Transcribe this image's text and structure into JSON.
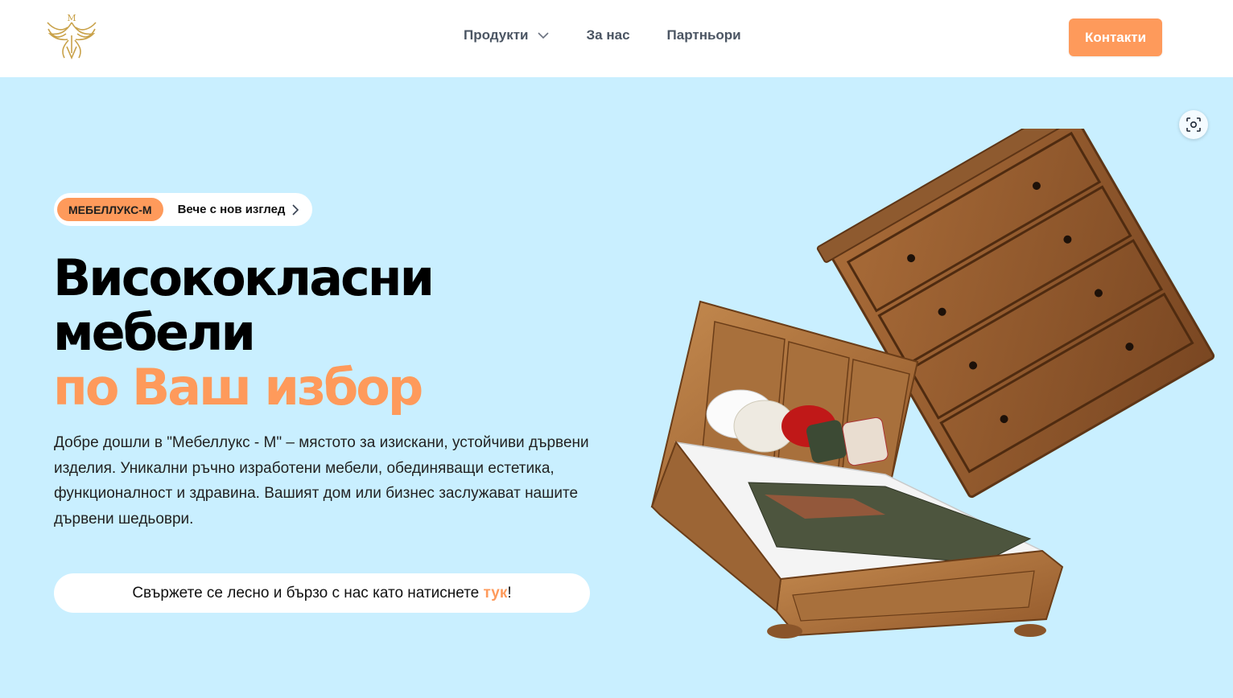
{
  "header": {
    "logo_alt": "Мебеллукс-М лого",
    "nav": [
      {
        "label": "Продукти",
        "has_dropdown": true
      },
      {
        "label": "За нас"
      },
      {
        "label": "Партньори"
      }
    ],
    "contacts_label": "Контакти"
  },
  "hero": {
    "pill": {
      "badge": "МЕБЕЛЛУКС-М",
      "text": "Вече с нов изглед"
    },
    "title_line1": "Висококласни",
    "title_line2": "мебели",
    "title_accent": "по Ваш избор",
    "description": "Добре дошли в \"Мебеллукс - М\" – мястото за изискани, устойчиви дървени изделия. Уникални ръчно изработени мебели, обединяващи естетика, функционалност и здравина. Вашият дом или бизнес заслужават нашите дървени шедьоври.",
    "cta_prefix": "Свържете се лесно и бързо с нас като натиснете ",
    "cta_link": "тук",
    "cta_suffix": "!"
  },
  "colors": {
    "accent": "#fe9a5b",
    "hero_bg": "#c9efff",
    "wood": "#9a6233"
  },
  "icons": [
    "logo-phoenix-icon",
    "chevron-down-icon",
    "chevron-right-icon",
    "focus-scan-icon"
  ]
}
